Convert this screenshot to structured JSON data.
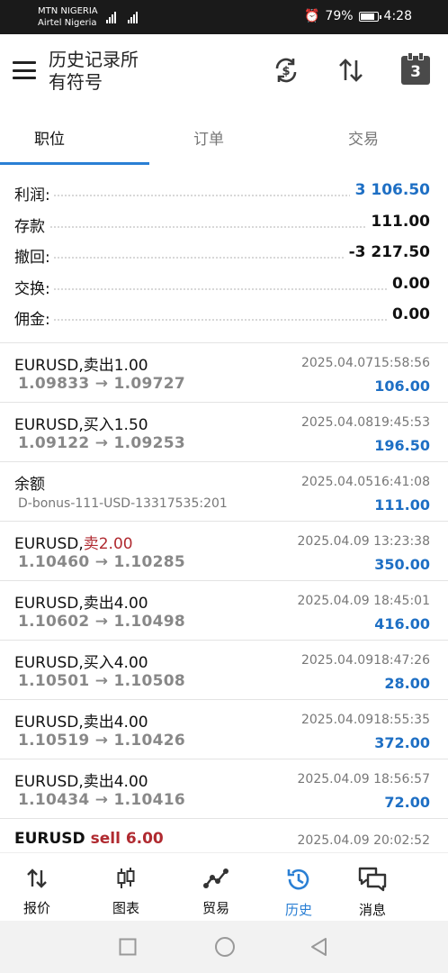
{
  "status": {
    "carrier1": "MTN NIGERIA",
    "carrier2": "Airtel Nigeria",
    "battery": "79%",
    "time": "4:28"
  },
  "appbar": {
    "title_line1": "历史记录所",
    "title_line2": "有符号",
    "calendar_day": "3"
  },
  "tabs": [
    "职位",
    "订单",
    "交易"
  ],
  "summary": [
    {
      "label": "利润:",
      "value": "3 106.50"
    },
    {
      "label": "存款",
      "value": "111.00"
    },
    {
      "label": "撤回:",
      "value": "-3 217.50"
    },
    {
      "label": "交换:",
      "value": "0.00"
    },
    {
      "label": "佣金:",
      "value": "0.00"
    }
  ],
  "deals": [
    {
      "symbol": "EURUSD,卖出1.00",
      "time": "2025.04.0715:58:56",
      "prices": "1.09833 → 1.09727",
      "profit": "106.00"
    },
    {
      "symbol": "EURUSD,买入1.50",
      "time": "2025.04.0819:45:53",
      "prices": "1.09122 → 1.09253",
      "profit": "196.50"
    },
    {
      "symbol": "余额",
      "time": "2025.04.0516:41:08",
      "comment": "D-bonus-111-USD-13317535:201",
      "profit": "111.00"
    },
    {
      "symbol_prefix": "EURUSD,",
      "symbol_red": "卖2.00",
      "time": "2025.04.09 13:23:38",
      "prices": "1.10460 → 1.10285",
      "profit": "350.00"
    },
    {
      "symbol": "EURUSD,卖出4.00",
      "time": "2025.04.09 18:45:01",
      "prices": "1.10602 → 1.10498",
      "profit": "416.00"
    },
    {
      "symbol": "EURUSD,买入4.00",
      "time": "2025.04.0918:47:26",
      "prices": "1.10501 → 1.10508",
      "profit": "28.00"
    },
    {
      "symbol": "EURUSD,卖出4.00",
      "time": "2025.04.0918:55:35",
      "prices": "1.10519 → 1.10426",
      "profit": "372.00"
    },
    {
      "symbol": "EURUSD,卖出4.00",
      "time": "2025.04.09 18:56:57",
      "prices": "1.10434 → 1.10416",
      "profit": "72.00"
    },
    {
      "symbol_prefix": "EURUSD",
      "symbol_red": "sell 6.00",
      "time": "2025.04.09 20:02:52"
    }
  ],
  "nav": [
    "报价",
    "图表",
    "贸易",
    "历史",
    "消息"
  ],
  "colors": {
    "accent": "#2a7fd4",
    "profit_blue": "#1e6fc4",
    "sell_red": "#b02a30"
  }
}
